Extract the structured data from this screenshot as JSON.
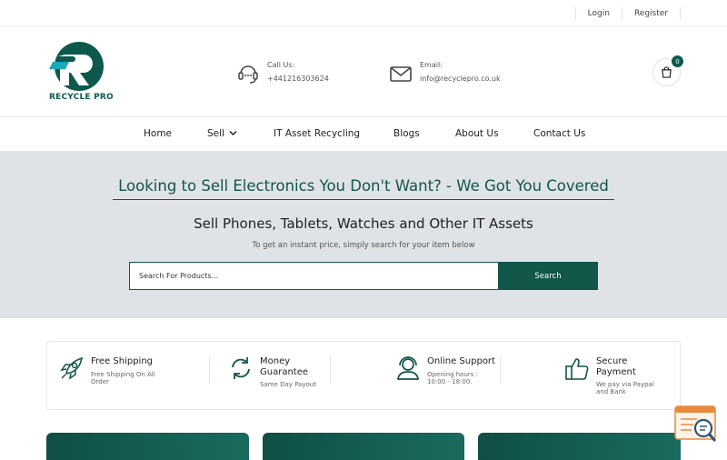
{
  "topbar": {
    "login": "Login",
    "register": "Register"
  },
  "brand": {
    "name": "RECYCLE PRO"
  },
  "contact": {
    "call_label": "Call Us:",
    "call_value": "+441216303624",
    "email_label": "Email:",
    "email_value": "info@recyclepro.co.uk"
  },
  "cart": {
    "count": "0"
  },
  "nav": {
    "home": "Home",
    "sell": "Sell",
    "it_asset": "IT Asset Recycling",
    "blogs": "Blogs",
    "about": "About Us",
    "contact": "Contact Us"
  },
  "hero": {
    "headline": "Looking to Sell Electronics You Don't Want? - We Got You Covered",
    "subheadline": "Sell Phones, Tablets, Watches and Other IT Assets",
    "tagline": "To get an instant price, simply search for your item below",
    "search_placeholder": "Search For Products...",
    "search_button": "Search"
  },
  "features": [
    {
      "title": "Free Shipping",
      "subtitle": "Free Shipping On All Order",
      "icon": "rocket-icon"
    },
    {
      "title": "Money Guarantee",
      "subtitle": "Same Day Payout",
      "icon": "refresh-icon"
    },
    {
      "title": "Online Support",
      "subtitle": "Opening hours : 10:00 - 18:00.",
      "icon": "support-agent-icon"
    },
    {
      "title": "Secure Payment",
      "subtitle": "We pay via Paypal and Bank",
      "icon": "thumbs-up-icon"
    }
  ],
  "colors": {
    "brand": "#13564a",
    "hero_bg": "#dfe2e7"
  }
}
